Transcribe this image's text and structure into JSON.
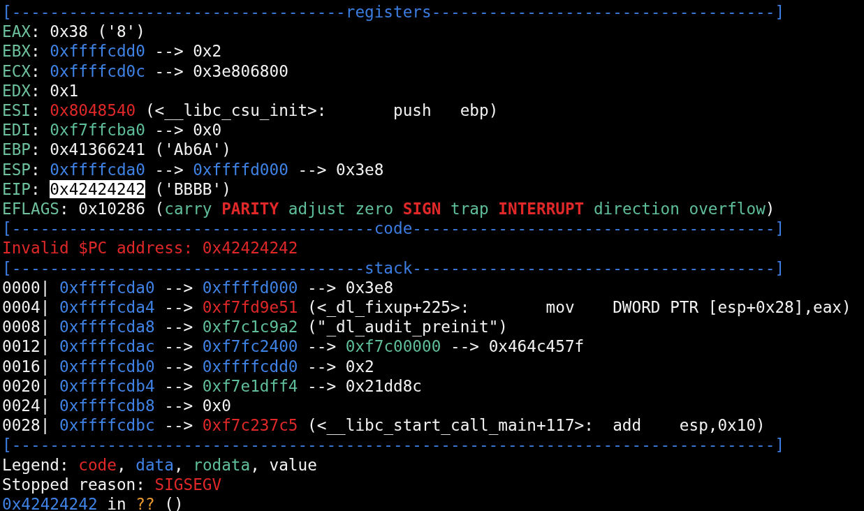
{
  "terminal": {
    "lines": [
      {
        "kind": "rule",
        "segments": [
          {
            "kind": "rule",
            "text": "[-----------------------------------registers------------------------------------]"
          }
        ]
      },
      {
        "kind": "line",
        "segments": [
          {
            "kind": "label",
            "text": "EAX"
          },
          {
            "kind": "value",
            "text": ": 0x38 ('8')"
          }
        ]
      },
      {
        "kind": "line",
        "segments": [
          {
            "kind": "label",
            "text": "EBX"
          },
          {
            "kind": "value",
            "text": ": "
          },
          {
            "kind": "data",
            "text": "0xffffcdd0"
          },
          {
            "kind": "value",
            "text": " --> 0x2"
          }
        ]
      },
      {
        "kind": "line",
        "segments": [
          {
            "kind": "label",
            "text": "ECX"
          },
          {
            "kind": "value",
            "text": ": "
          },
          {
            "kind": "data",
            "text": "0xffffcd0c"
          },
          {
            "kind": "value",
            "text": " --> 0x3e806800"
          }
        ]
      },
      {
        "kind": "line",
        "segments": [
          {
            "kind": "label",
            "text": "EDX"
          },
          {
            "kind": "value",
            "text": ": 0x1"
          }
        ]
      },
      {
        "kind": "line",
        "segments": [
          {
            "kind": "label",
            "text": "ESI"
          },
          {
            "kind": "value",
            "text": ": "
          },
          {
            "kind": "code",
            "text": "0x8048540"
          },
          {
            "kind": "value",
            "text": " (<__libc_csu_init>:       push   ebp)"
          }
        ]
      },
      {
        "kind": "line",
        "segments": [
          {
            "kind": "label",
            "text": "EDI"
          },
          {
            "kind": "value",
            "text": ": "
          },
          {
            "kind": "rodata",
            "text": "0xf7ffcba0"
          },
          {
            "kind": "value",
            "text": " --> 0x0"
          }
        ]
      },
      {
        "kind": "line",
        "segments": [
          {
            "kind": "label",
            "text": "EBP"
          },
          {
            "kind": "value",
            "text": ": 0x41366241 ('Ab6A')"
          }
        ]
      },
      {
        "kind": "line",
        "segments": [
          {
            "kind": "label",
            "text": "ESP"
          },
          {
            "kind": "value",
            "text": ": "
          },
          {
            "kind": "data",
            "text": "0xffffcda0"
          },
          {
            "kind": "value",
            "text": " --> "
          },
          {
            "kind": "data",
            "text": "0xffffd000"
          },
          {
            "kind": "value",
            "text": " --> 0x3e8"
          }
        ]
      },
      {
        "kind": "line",
        "segments": [
          {
            "kind": "label",
            "text": "EIP"
          },
          {
            "kind": "value",
            "text": ": "
          },
          {
            "kind": "highlight",
            "text": "0x42424242"
          },
          {
            "kind": "value",
            "text": " ('BBBB')"
          }
        ]
      },
      {
        "kind": "line",
        "segments": [
          {
            "kind": "label",
            "text": "EFLAGS"
          },
          {
            "kind": "value",
            "text": ": 0x10286 ("
          },
          {
            "kind": "flag_off",
            "text": "carry "
          },
          {
            "kind": "flag_on",
            "text": "PARITY"
          },
          {
            "kind": "flag_off",
            "text": " adjust zero "
          },
          {
            "kind": "flag_on",
            "text": "SIGN"
          },
          {
            "kind": "flag_off",
            "text": " trap "
          },
          {
            "kind": "flag_on",
            "text": "INTERRUPT"
          },
          {
            "kind": "flag_off",
            "text": " direction overflow"
          },
          {
            "kind": "value",
            "text": ")"
          }
        ]
      },
      {
        "kind": "rule",
        "segments": [
          {
            "kind": "rule",
            "text": "[--------------------------------------code--------------------------------------]"
          }
        ]
      },
      {
        "kind": "line",
        "segments": [
          {
            "kind": "code",
            "text": "Invalid $PC address: 0x42424242"
          }
        ]
      },
      {
        "kind": "rule",
        "segments": [
          {
            "kind": "rule",
            "text": "[-------------------------------------stack--------------------------------------]"
          }
        ]
      },
      {
        "kind": "line",
        "segments": [
          {
            "kind": "value",
            "text": "0000| "
          },
          {
            "kind": "data",
            "text": "0xffffcda0"
          },
          {
            "kind": "value",
            "text": " --> "
          },
          {
            "kind": "data",
            "text": "0xffffd000"
          },
          {
            "kind": "value",
            "text": " --> 0x3e8"
          }
        ]
      },
      {
        "kind": "line",
        "segments": [
          {
            "kind": "value",
            "text": "0004| "
          },
          {
            "kind": "data",
            "text": "0xffffcda4"
          },
          {
            "kind": "value",
            "text": " --> "
          },
          {
            "kind": "code",
            "text": "0xf7fd9e51"
          },
          {
            "kind": "value",
            "text": " (<_dl_fixup+225>:        mov    DWORD PTR [esp+0x28],eax)"
          }
        ]
      },
      {
        "kind": "line",
        "segments": [
          {
            "kind": "value",
            "text": "0008| "
          },
          {
            "kind": "data",
            "text": "0xffffcda8"
          },
          {
            "kind": "value",
            "text": " --> "
          },
          {
            "kind": "rodata",
            "text": "0xf7c1c9a2"
          },
          {
            "kind": "value",
            "text": " (\"_dl_audit_preinit\")"
          }
        ]
      },
      {
        "kind": "line",
        "segments": [
          {
            "kind": "value",
            "text": "0012| "
          },
          {
            "kind": "data",
            "text": "0xffffcdac"
          },
          {
            "kind": "value",
            "text": " --> "
          },
          {
            "kind": "data",
            "text": "0xf7fc2400"
          },
          {
            "kind": "value",
            "text": " --> "
          },
          {
            "kind": "rodata",
            "text": "0xf7c00000"
          },
          {
            "kind": "value",
            "text": " --> 0x464c457f"
          }
        ]
      },
      {
        "kind": "line",
        "segments": [
          {
            "kind": "value",
            "text": "0016| "
          },
          {
            "kind": "data",
            "text": "0xffffcdb0"
          },
          {
            "kind": "value",
            "text": " --> "
          },
          {
            "kind": "data",
            "text": "0xffffcdd0"
          },
          {
            "kind": "value",
            "text": " --> 0x2"
          }
        ]
      },
      {
        "kind": "line",
        "segments": [
          {
            "kind": "value",
            "text": "0020| "
          },
          {
            "kind": "data",
            "text": "0xffffcdb4"
          },
          {
            "kind": "value",
            "text": " --> "
          },
          {
            "kind": "rodata",
            "text": "0xf7e1dff4"
          },
          {
            "kind": "value",
            "text": " --> 0x21dd8c"
          }
        ]
      },
      {
        "kind": "line",
        "segments": [
          {
            "kind": "value",
            "text": "0024| "
          },
          {
            "kind": "data",
            "text": "0xffffcdb8"
          },
          {
            "kind": "value",
            "text": " --> 0x0"
          }
        ]
      },
      {
        "kind": "line",
        "segments": [
          {
            "kind": "value",
            "text": "0028| "
          },
          {
            "kind": "data",
            "text": "0xffffcdbc"
          },
          {
            "kind": "value",
            "text": " --> "
          },
          {
            "kind": "code",
            "text": "0xf7c237c5"
          },
          {
            "kind": "value",
            "text": " (<__libc_start_call_main+117>:  add    esp,0x10)"
          }
        ]
      },
      {
        "kind": "rule",
        "segments": [
          {
            "kind": "rule",
            "text": "[--------------------------------------------------------------------------------]"
          }
        ]
      },
      {
        "kind": "line",
        "segments": [
          {
            "kind": "value",
            "text": "Legend: "
          },
          {
            "kind": "code",
            "text": "code"
          },
          {
            "kind": "value",
            "text": ", "
          },
          {
            "kind": "data",
            "text": "data"
          },
          {
            "kind": "value",
            "text": ", "
          },
          {
            "kind": "rodata",
            "text": "rodata"
          },
          {
            "kind": "value",
            "text": ", value"
          }
        ]
      },
      {
        "kind": "line",
        "segments": [
          {
            "kind": "value",
            "text": "Stopped reason: "
          },
          {
            "kind": "code",
            "text": "SIGSEGV"
          }
        ]
      },
      {
        "kind": "line",
        "segments": [
          {
            "kind": "data",
            "text": "0x42424242"
          },
          {
            "kind": "value",
            "text": " in "
          },
          {
            "kind": "unknown",
            "text": "??"
          },
          {
            "kind": "value",
            "text": " ()"
          }
        ]
      }
    ]
  }
}
